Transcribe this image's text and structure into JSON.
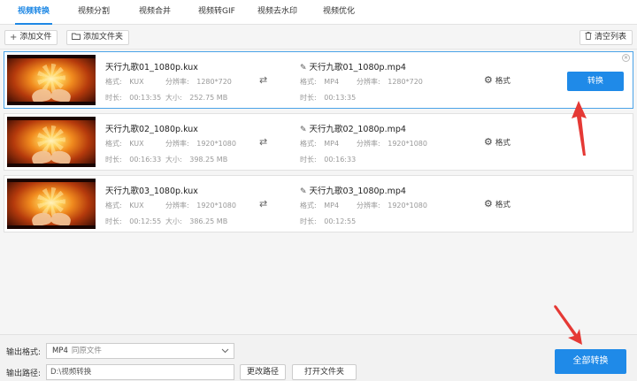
{
  "tabs": [
    {
      "label": "视频转换",
      "active": true
    },
    {
      "label": "视频分割",
      "active": false
    },
    {
      "label": "视频合并",
      "active": false
    },
    {
      "label": "视频转GIF",
      "active": false
    },
    {
      "label": "视频去水印",
      "active": false
    },
    {
      "label": "视频优化",
      "active": false
    }
  ],
  "toolbar": {
    "add_file": "添加文件",
    "add_folder": "添加文件夹",
    "clear_list": "清空列表"
  },
  "files": [
    {
      "source_name": "天行九歌01_1080p.kux",
      "format_label": "格式:",
      "format_value": "KUX",
      "resolution_label": "分辨率:",
      "resolution_value": "1280*720",
      "duration_label": "时长:",
      "duration_value": "00:13:35",
      "size_label": "大小:",
      "size_value": "252.75 MB",
      "output_name": "天行九歌01_1080p.mp4",
      "out_format_label": "格式:",
      "out_format_value": "MP4",
      "out_resolution_label": "分辨率:",
      "out_resolution_value": "1280*720",
      "out_duration_label": "时长:",
      "out_duration_value": "00:13:35",
      "settings_label": "格式",
      "convert_label": "转换",
      "selected": true
    },
    {
      "source_name": "天行九歌02_1080p.kux",
      "format_label": "格式:",
      "format_value": "KUX",
      "resolution_label": "分辨率:",
      "resolution_value": "1920*1080",
      "duration_label": "时长:",
      "duration_value": "00:16:33",
      "size_label": "大小:",
      "size_value": "398.25 MB",
      "output_name": "天行九歌02_1080p.mp4",
      "out_format_label": "格式:",
      "out_format_value": "MP4",
      "out_resolution_label": "分辨率:",
      "out_resolution_value": "1920*1080",
      "out_duration_label": "时长:",
      "out_duration_value": "00:16:33",
      "settings_label": "格式",
      "selected": false
    },
    {
      "source_name": "天行九歌03_1080p.kux",
      "format_label": "格式:",
      "format_value": "KUX",
      "resolution_label": "分辨率:",
      "resolution_value": "1920*1080",
      "duration_label": "时长:",
      "duration_value": "00:12:55",
      "size_label": "大小:",
      "size_value": "386.25 MB",
      "output_name": "天行九歌03_1080p.mp4",
      "out_format_label": "格式:",
      "out_format_value": "MP4",
      "out_resolution_label": "分辨率:",
      "out_resolution_value": "1920*1080",
      "out_duration_label": "时长:",
      "out_duration_value": "00:12:55",
      "settings_label": "格式",
      "selected": false
    }
  ],
  "bottom": {
    "output_format_label": "输出格式:",
    "output_format_value": "MP4",
    "output_format_sub": "同原文件",
    "output_path_label": "输出路径:",
    "output_path_value": "D:\\视频转换",
    "change_path": "更改路径",
    "open_folder": "打开文件夹",
    "convert_all": "全部转换"
  },
  "colors": {
    "accent": "#1f8ae8",
    "annotation_arrow": "#e53935"
  }
}
